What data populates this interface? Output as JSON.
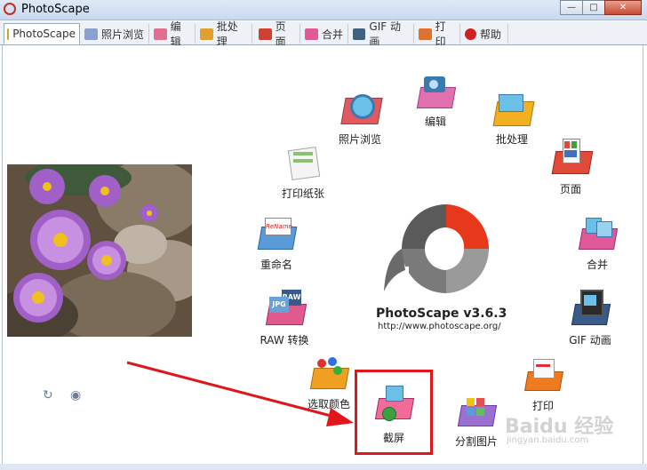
{
  "window": {
    "title": "PhotoScape",
    "buttons": [
      "minimize",
      "maximize",
      "close"
    ]
  },
  "tabs": [
    {
      "label": "PhotoScape",
      "active": true,
      "color": "#d0a030"
    },
    {
      "label": "照片浏览",
      "color": "#8aa0d0"
    },
    {
      "label": "编辑",
      "color": "#e07090"
    },
    {
      "label": "批处理",
      "color": "#e0a030"
    },
    {
      "label": "页面",
      "color": "#d04030"
    },
    {
      "label": "合并",
      "color": "#e05a9a"
    },
    {
      "label": "GIF 动画",
      "color": "#406080"
    },
    {
      "label": "打印",
      "color": "#e07030"
    },
    {
      "label": "帮助",
      "color": "#d02020"
    }
  ],
  "main": {
    "items": [
      {
        "label": "照片浏览",
        "icon": "photo-viewer-icon"
      },
      {
        "label": "编辑",
        "icon": "editor-icon"
      },
      {
        "label": "批处理",
        "icon": "batch-editor-icon"
      },
      {
        "label": "打印纸张",
        "icon": "print-paper-icon"
      },
      {
        "label": "页面",
        "icon": "page-icon"
      },
      {
        "label": "重命名",
        "icon": "rename-icon"
      },
      {
        "label": "合并",
        "icon": "combine-icon"
      },
      {
        "label": "RAW 转换",
        "icon": "raw-converter-icon"
      },
      {
        "label": "GIF 动画",
        "icon": "gif-animation-icon"
      },
      {
        "label": "选取颜色",
        "icon": "color-picker-icon"
      },
      {
        "label": "打印",
        "icon": "print-icon"
      },
      {
        "label": "截屏",
        "icon": "screen-capture-icon"
      },
      {
        "label": "分割图片",
        "icon": "splitter-icon"
      }
    ],
    "logo": {
      "name": "PhotoScape v3.6.3",
      "url": "http://www.photoscape.org/"
    }
  },
  "watermark": {
    "text": "Baidu 经验",
    "sub": "jingyan.baidu.com"
  },
  "colors": {
    "highlight": "#e0161b",
    "arrow": "#e0161b",
    "logo_red": "#e8381c",
    "logo_gray": "#8a8a8a"
  }
}
